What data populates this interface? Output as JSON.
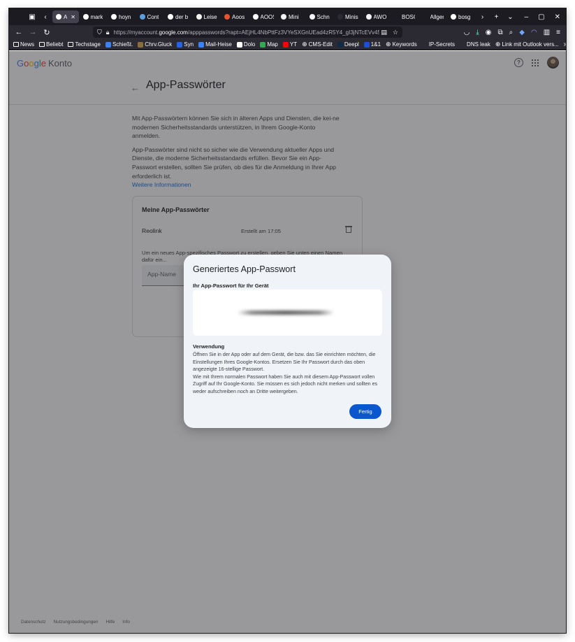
{
  "browser": {
    "tabs": [
      {
        "label": "App",
        "active": true,
        "color": "#ffffff"
      },
      {
        "label": "mark",
        "color": "#ffffff"
      },
      {
        "label": "hoyn",
        "color": "#ffffff"
      },
      {
        "label": "Cont",
        "color": "#5aa0e0"
      },
      {
        "label": "der b",
        "color": "#ffffff"
      },
      {
        "label": "Leise",
        "color": "#f4f4f4"
      },
      {
        "label": "Aoos",
        "color": "#e8542b"
      },
      {
        "label": "AOOS",
        "color": "#ffffff"
      },
      {
        "label": "Mini",
        "color": "#f4f4f4"
      },
      {
        "label": "Schn",
        "color": "#f4f4f4"
      },
      {
        "label": "Minis",
        "color": "#2b2a33"
      },
      {
        "label": "AWO",
        "color": "#f4f4f4"
      },
      {
        "label": "BOSGAM",
        "color": "#1c1b22"
      },
      {
        "label": "Allgemei",
        "color": "#1c1b22"
      },
      {
        "label": "bosg",
        "color": "#ffffff"
      }
    ],
    "url_prefix": "https://myaccount.",
    "url_domain": "google.com",
    "url_rest": "/apppasswords?rapt=AEjHL4NbPttFz3VYeSXGnUEad4zR5Y4_gI3jNTcEVv45vLCl",
    "bookmarks": [
      {
        "label": "News",
        "icon": "folder"
      },
      {
        "label": "Beliebt",
        "icon": "folder"
      },
      {
        "label": "Techstage",
        "icon": "folder"
      },
      {
        "label": "Schießt.",
        "icon": "site",
        "color": "#3b82f6"
      },
      {
        "label": "Chrv.Gluck",
        "icon": "site",
        "color": "#8a6d3b"
      },
      {
        "label": "Syn",
        "icon": "site",
        "color": "#2563eb"
      },
      {
        "label": "Mail-Heise",
        "icon": "site",
        "color": "#3b82f6"
      },
      {
        "label": "Dolo",
        "icon": "site",
        "color": "#ffffff"
      },
      {
        "label": "Map",
        "icon": "site",
        "color": "#34a853"
      },
      {
        "label": "YT",
        "icon": "site",
        "color": "#ff0000"
      },
      {
        "label": "CMS-Edit",
        "icon": "globe"
      },
      {
        "label": "Deepl",
        "icon": "site",
        "color": "#0f2b46"
      },
      {
        "label": "1&1",
        "icon": "site",
        "color": "#1d4ed8"
      },
      {
        "label": "Keywords",
        "icon": "globe"
      },
      {
        "label": "IP-Secrets",
        "icon": "site",
        "color": "#2b2a33"
      },
      {
        "label": "DNS leak",
        "icon": "site",
        "color": "#2b2a33"
      },
      {
        "label": "Link mit Outlook vers...",
        "icon": "globe"
      }
    ]
  },
  "header": {
    "logo_letters": [
      "G",
      "o",
      "o",
      "g",
      "l",
      "e"
    ],
    "product": "Konto"
  },
  "page": {
    "title": "App-Passwörter",
    "intro1": "Mit App-Passwörtern können Sie sich in älteren Apps und Diensten, die kei-ne modernen Sicherheitsstandards unterstützen, in Ihrem Google-Konto anmelden.",
    "intro2": "App-Passwörter sind nicht so sicher wie die Verwendung aktueller Apps und Dienste, die moderne Sicherheitsstandards erfüllen. Bevor Sie ein App-Passwort erstellen, sollten Sie prüfen, ob dies für die Anmeldung in Ihrer App erforderlich ist.",
    "more_link": "Weitere Informationen"
  },
  "card": {
    "title": "Meine App-Passwörter",
    "rows": [
      {
        "name": "Reolink",
        "created": "Erstellt am 17:05"
      }
    ],
    "hint": "Um ein neues App-spezifisches Passwort zu erstellen, geben Sie unten einen Namen dafür ein...",
    "input_placeholder": "App-Name"
  },
  "footer": [
    "Datenschutz",
    "Nutzungsbedingungen",
    "Hilfe",
    "Info"
  ],
  "dialog": {
    "title": "Generiertes App-Passwort",
    "subtitle": "Ihr App-Passwort für Ihr Gerät",
    "usage_heading": "Verwendung",
    "usage_p1": "Öffnen Sie in der App oder auf dem Gerät, die bzw. das Sie einrichten möchten, die Einstellungen Ihres Google-Kontos. Ersetzen Sie Ihr Passwort durch das oben angezeigte 16-stellige Passwort.",
    "usage_p2": "Wie mit Ihrem normalen Passwort haben Sie auch mit diesem App-Passwort vollen Zugriff auf Ihr Google-Konto. Sie müssen es sich jedoch nicht merken und sollten es weder aufschreiben noch an Dritte weitergeben.",
    "done_button": "Fertig"
  },
  "colors": {
    "accent": "#0b57d0",
    "link": "#1a73e8"
  }
}
